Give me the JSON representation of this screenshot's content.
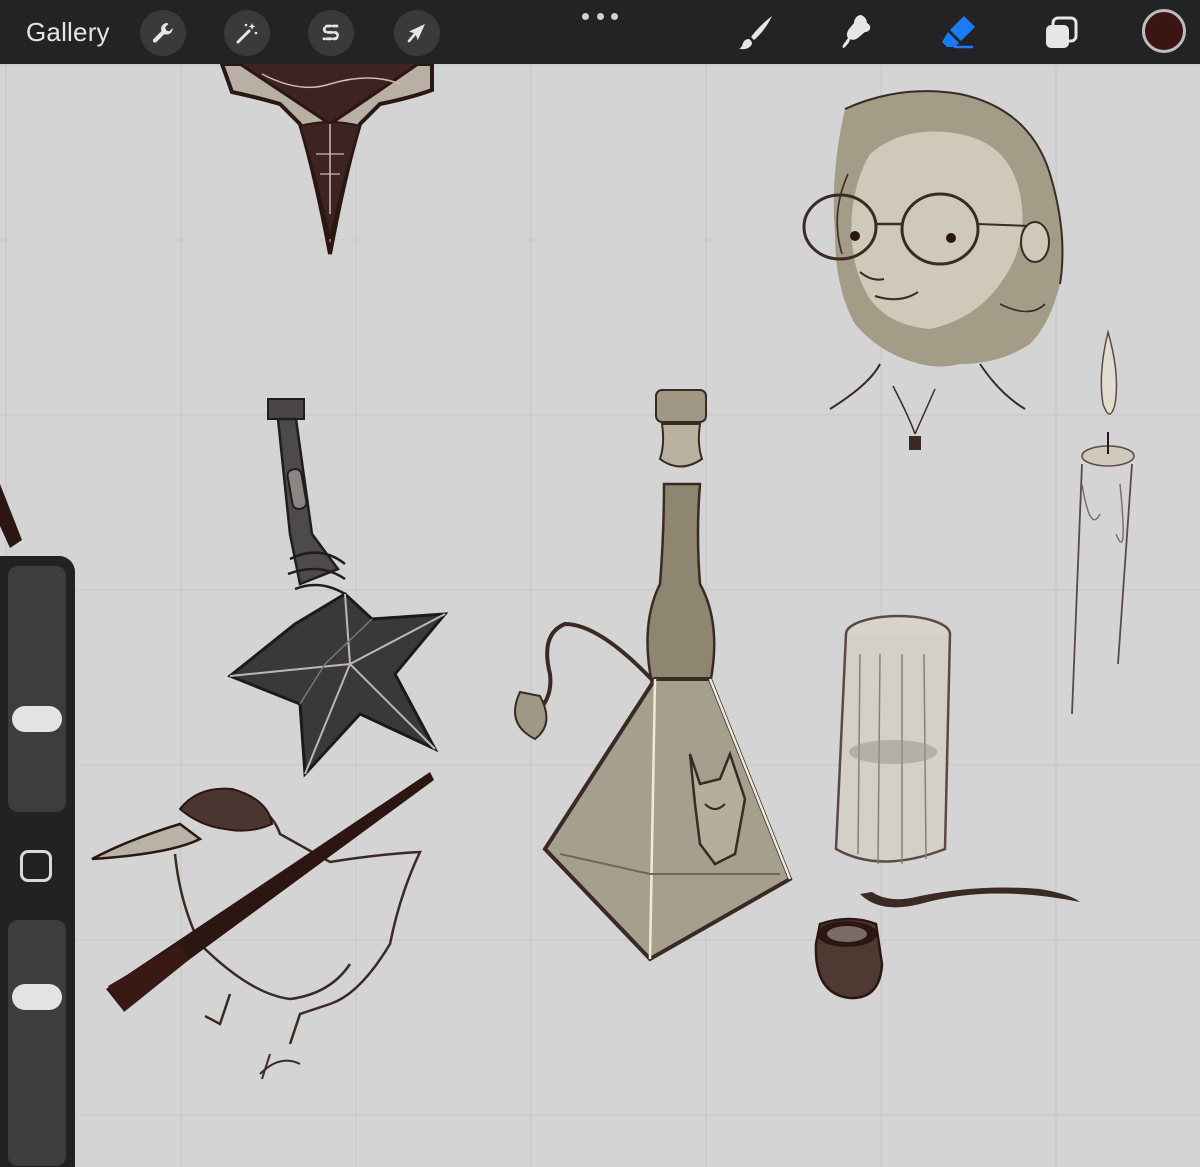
{
  "app": {
    "gallery_label": "Gallery"
  },
  "toolbar": {
    "left_tools": [
      {
        "name": "actions",
        "icon": "wrench-icon"
      },
      {
        "name": "adjustments",
        "icon": "magic-wand-icon"
      },
      {
        "name": "selection",
        "icon": "selection-s-icon"
      },
      {
        "name": "transform",
        "icon": "arrow-cursor-icon"
      }
    ],
    "more_icon": "ellipsis-icon",
    "right_tools": [
      {
        "name": "brush",
        "icon": "brush-icon",
        "active": false
      },
      {
        "name": "smudge",
        "icon": "smudge-icon",
        "active": false
      },
      {
        "name": "eraser",
        "icon": "eraser-icon",
        "active": true
      },
      {
        "name": "layers",
        "icon": "layers-icon",
        "active": false
      }
    ],
    "accent_color": "#1a7cf5",
    "current_color": "#3a1511"
  },
  "sidebar": {
    "brush_size_level": 0.2,
    "opacity_level": 0.45,
    "modify_button_icon": "square-outline-icon"
  },
  "canvas": {
    "background": "#d4d4d4",
    "grid_color": "#c6c6c6",
    "ink_color": "#2b1612",
    "tone_color": "#9e9884",
    "sketches": [
      "ornate-pendant-sketch",
      "girl-with-glasses-portrait-sketch",
      "lit-candle-sketch",
      "star-potion-bottle-sketch",
      "pyramid-flask-with-fox-sketch",
      "drinking-glass-sketch",
      "tobacco-pipe-sketch",
      "bird-with-rifle-sketch"
    ]
  }
}
